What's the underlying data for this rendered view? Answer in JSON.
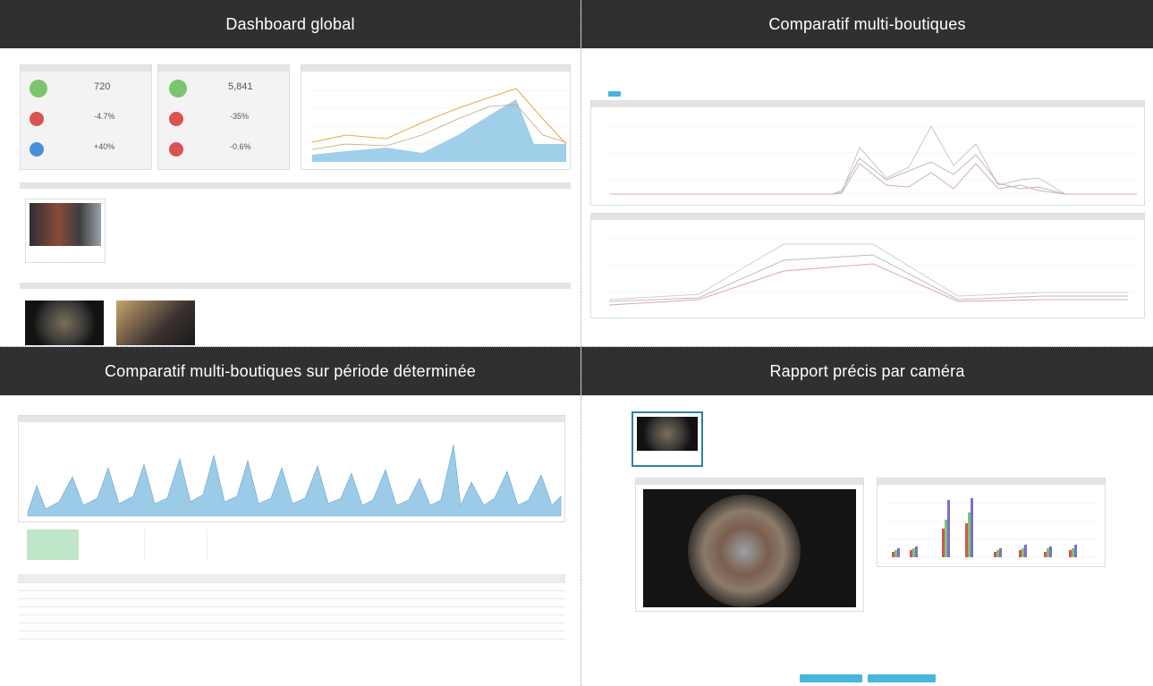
{
  "panels": [
    {
      "title": "Dashboard global"
    },
    {
      "title": "Comparatif multi-boutiques"
    },
    {
      "title": "Comparatif multi-boutiques sur période déterminée"
    },
    {
      "title": "Rapport précis par caméra"
    }
  ],
  "dashboard": {
    "kpi1": {
      "value": "720",
      "delta1": "-4.7%",
      "delta2": "+40%"
    },
    "kpi2": {
      "value": "5,841",
      "delta1": "-35%",
      "delta2": "-0.6%"
    }
  },
  "colors": {
    "header_bg": "#2e3032",
    "accent_blue": "#46b6dc",
    "green": "#7cc56f",
    "red": "#d9534f",
    "blue": "#4a90d9"
  },
  "icons": [
    "thumbs-up-icon",
    "thumbs-down-icon",
    "trend-icon"
  ]
}
